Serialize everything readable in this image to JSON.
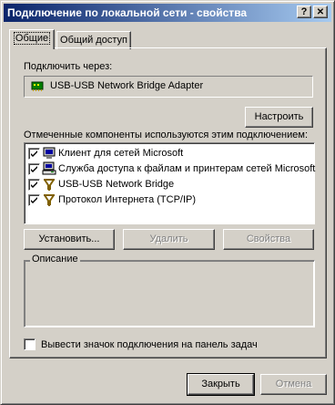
{
  "window": {
    "title": "Подключение по локальной сети - свойства",
    "help_glyph": "?",
    "close_glyph": "✕"
  },
  "tabs": [
    {
      "label": "Общие",
      "active": true
    },
    {
      "label": "Общий доступ",
      "active": false
    }
  ],
  "general": {
    "connect_using_label": "Подключить через:",
    "adapter_name": "USB-USB Network Bridge Adapter",
    "adapter_icon": "network-adapter-icon",
    "configure_button": "Настроить",
    "components_label": "Отмеченные компоненты используются этим подключением:",
    "components": [
      {
        "label": "Клиент для сетей Microsoft",
        "checked": true,
        "icon": "network-client-icon"
      },
      {
        "label": "Служба доступа к файлам и принтерам сетей Microsoft",
        "checked": true,
        "icon": "file-printer-service-icon"
      },
      {
        "label": "USB-USB Network Bridge",
        "checked": true,
        "icon": "protocol-icon"
      },
      {
        "label": "Протокол Интернета (TCP/IP)",
        "checked": true,
        "icon": "protocol-icon"
      }
    ],
    "install_button": "Установить...",
    "uninstall_button": "Удалить",
    "properties_button": "Свойства",
    "description_title": "Описание",
    "description_text": "",
    "show_icon_label": "Вывести значок подключения на панель задач",
    "show_icon_checked": false
  },
  "footer": {
    "close_button": "Закрыть",
    "cancel_button": "Отмена"
  },
  "colors": {
    "titlebar_start": "#0a246a",
    "titlebar_end": "#a6caf0",
    "face": "#d4d0c8"
  }
}
